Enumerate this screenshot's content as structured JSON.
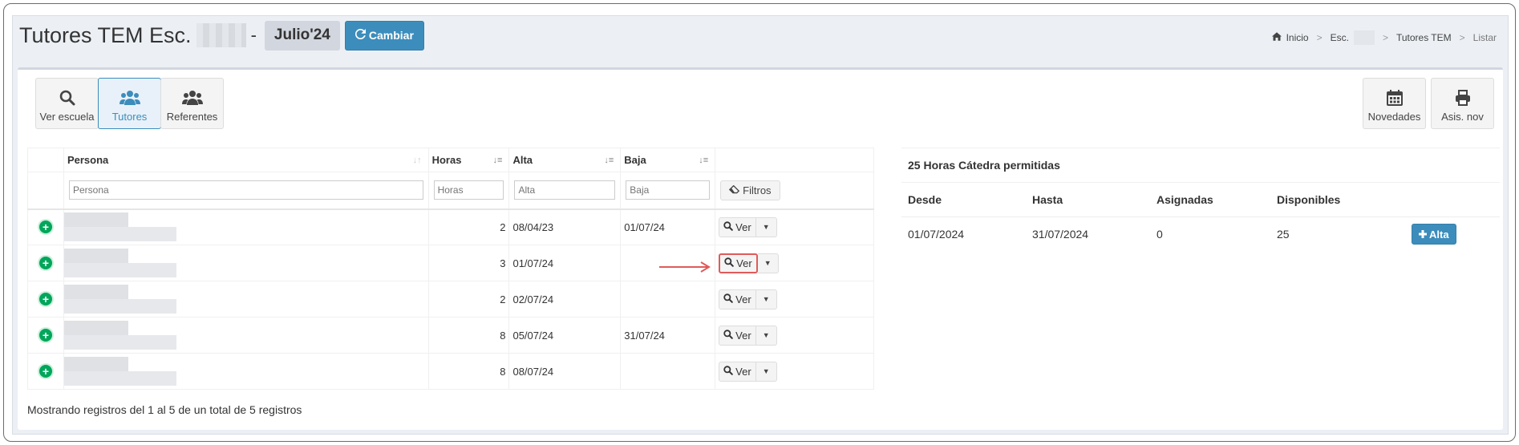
{
  "header": {
    "title": "Tutores TEM Esc.",
    "separator": "-",
    "month": "Julio'24",
    "change_button": "Cambiar"
  },
  "breadcrumb": {
    "home": "Inicio",
    "school": "Esc.",
    "section": "Tutores TEM",
    "current": "Listar"
  },
  "toolbar": {
    "ver_escuela": "Ver escuela",
    "tutores": "Tutores",
    "referentes": "Referentes",
    "novedades": "Novedades",
    "asis_nov": "Asis. nov"
  },
  "table": {
    "columns": {
      "persona": "Persona",
      "horas": "Horas",
      "alta": "Alta",
      "baja": "Baja"
    },
    "filters": {
      "persona": "Persona",
      "horas": "Horas",
      "alta": "Alta",
      "baja": "Baja",
      "button": "Filtros"
    },
    "rows": [
      {
        "horas": "2",
        "alta": "08/04/23",
        "baja": "01/07/24",
        "action": "Ver"
      },
      {
        "horas": "3",
        "alta": "01/07/24",
        "baja": "",
        "action": "Ver"
      },
      {
        "horas": "2",
        "alta": "02/07/24",
        "baja": "",
        "action": "Ver"
      },
      {
        "horas": "8",
        "alta": "05/07/24",
        "baja": "31/07/24",
        "action": "Ver"
      },
      {
        "horas": "8",
        "alta": "08/07/24",
        "baja": "",
        "action": "Ver"
      }
    ],
    "footer": "Mostrando registros del 1 al 5 de un total de 5 registros"
  },
  "hours_panel": {
    "title": "25 Horas Cátedra permitidas",
    "columns": {
      "desde": "Desde",
      "hasta": "Hasta",
      "asignadas": "Asignadas",
      "disponibles": "Disponibles"
    },
    "row": {
      "desde": "01/07/2024",
      "hasta": "31/07/2024",
      "asignadas": "0",
      "disponibles": "25"
    },
    "alta_button": "Alta"
  },
  "colors": {
    "primary": "#3c8dbc",
    "success": "#00a65a",
    "highlight": "#e05a5a",
    "background": "#ecf0f5"
  }
}
